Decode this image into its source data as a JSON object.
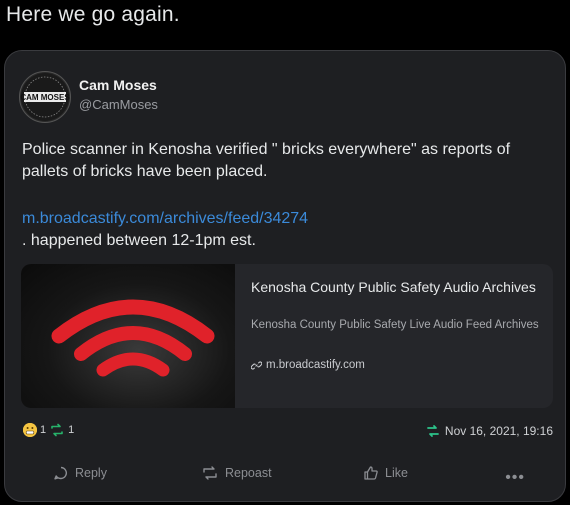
{
  "caption": "Here we go again.",
  "post": {
    "author_name": "Cam Moses",
    "author_handle": "@CamMoses",
    "avatar_text": "CAM MOSES",
    "body": "Police scanner in Kenosha verified \" bricks everywhere\" as reports of pallets of bricks have been placed.",
    "link": "m.broadcastify.com/archives/feed/34274",
    "time_note": ". happened between 12-1pm est.",
    "embed": {
      "title": "Kenosha County Public Safety Audio Archives",
      "description": "Kenosha County Public Safety Live Audio Feed Archives",
      "domain": "m.broadcastify.com"
    },
    "reaction_count": "1",
    "repost_count": "1",
    "date": "Nov 16, 2021, 19:16"
  },
  "actions": {
    "reply": "Reply",
    "repost": "Repoast",
    "like": "Like",
    "more": "•••"
  },
  "colors": {
    "link": "#3b8ad9",
    "signal_red": "#e0222a",
    "card_bg": "#1e1f22"
  }
}
